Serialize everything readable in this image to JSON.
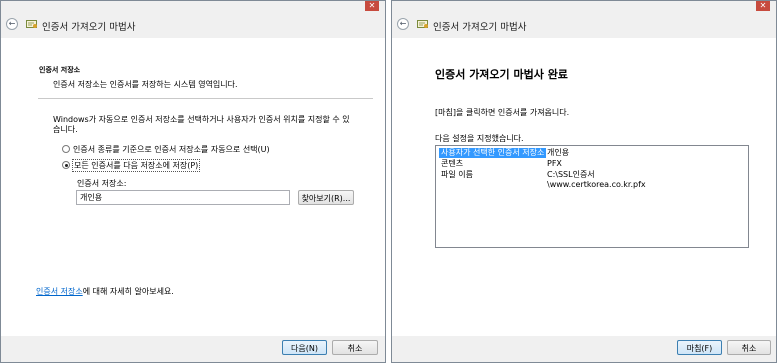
{
  "left_window": {
    "title": "인증서 가져오기 마법사",
    "close_glyph": "✕",
    "back_glyph": "←",
    "section_title": "인증서 저장소",
    "section_desc": "인증서 저장소는 인증서를 저장하는 시스템 영역입니다.",
    "instruction": "Windows가 자동으로 인증서 저장소를 선택하거나 사용자가 인증서 위치를 지정할 수 있습니다.",
    "radio_auto_label": "인증서 종류를 기준으로 인증서 저장소를 자동으로 선택(U)",
    "radio_manual_label": "모든 인증서를 다음 저장소에 저장(P)",
    "radio_selected": "manual",
    "store_label": "인증서 저장소:",
    "store_value": "개인용",
    "browse_label": "찾아보기(R)...",
    "learn_link": "인증서 저장소",
    "learn_rest": "에 대해 자세히 알아보세요.",
    "next_label": "다음(N)",
    "cancel_label": "취소"
  },
  "right_window": {
    "title": "인증서 가져오기 마법사",
    "close_glyph": "✕",
    "back_glyph": "←",
    "heading": "인증서 가져오기 마법사 완료",
    "finish_hint": "[마침]을 클릭하면 인증서를 가져옵니다.",
    "settings_label": "다음 설정을 지정했습니다.",
    "settings": [
      {
        "key": "사용자가 선택한 인증서 저장소",
        "value": "개인용",
        "selected": true
      },
      {
        "key": "콘텐츠",
        "value": "PFX",
        "selected": false
      },
      {
        "key": "파일 이름",
        "value": "C:\\SSL인증서\\www.certkorea.co.kr.pfx",
        "selected": false
      }
    ],
    "finish_label": "마침(F)",
    "cancel_label": "취소"
  },
  "icons": {
    "back": "back-arrow-icon",
    "wizard": "certificate-wizard-icon",
    "close": "close-icon"
  },
  "colors": {
    "close_button": "#c74b3e",
    "selection": "#3399ff",
    "link": "#0066cc",
    "primary_button_border": "#3c7fb1"
  }
}
